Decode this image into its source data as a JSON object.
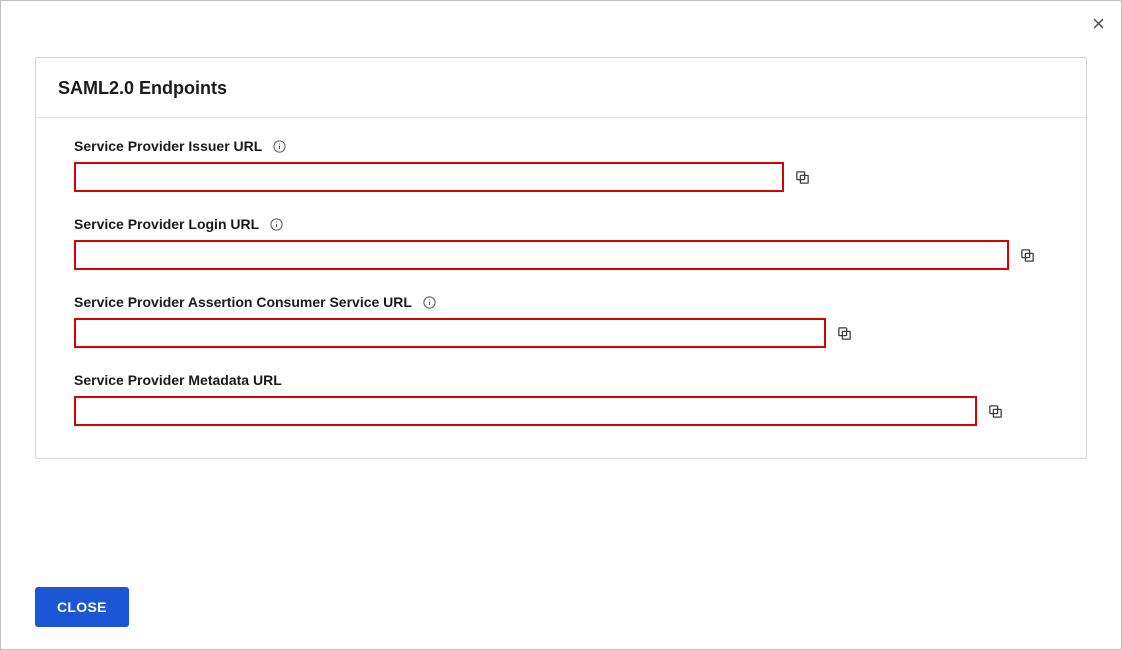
{
  "dialog": {
    "close_x": "×"
  },
  "card": {
    "title": "SAML2.0 Endpoints"
  },
  "fields": {
    "issuer": {
      "label": "Service Provider Issuer URL",
      "value": "",
      "has_info": true
    },
    "login": {
      "label": "Service Provider Login URL",
      "value": "",
      "has_info": true
    },
    "acs": {
      "label": "Service Provider Assertion Consumer Service URL",
      "value": "",
      "has_info": true
    },
    "metadata": {
      "label": "Service Provider Metadata URL",
      "value": "",
      "has_info": false
    }
  },
  "footer": {
    "close_label": "Close"
  },
  "colors": {
    "highlight_border": "#dd0000",
    "primary_button": "#1b56d4"
  }
}
